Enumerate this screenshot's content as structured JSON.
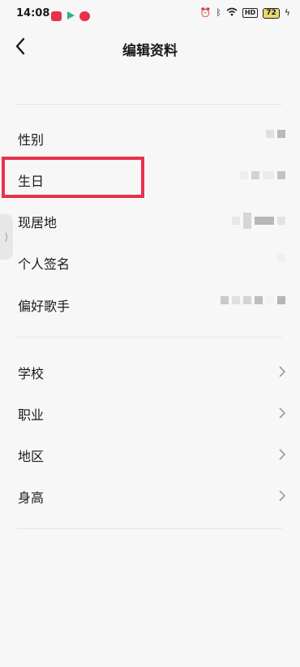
{
  "status_bar": {
    "time": "14:08",
    "battery": "72",
    "hd": "HD",
    "icons": [
      "app-notification-icon",
      "play-store-icon",
      "app-icon",
      "alarm-icon",
      "bluetooth-icon",
      "wifi-icon",
      "hd-icon",
      "battery-icon",
      "charging-icon"
    ]
  },
  "header": {
    "title": "编辑资料"
  },
  "profile_fields": [
    {
      "label": "性别"
    },
    {
      "label": "生日"
    },
    {
      "label": "现居地"
    },
    {
      "label": "个人签名"
    },
    {
      "label": "偏好歌手"
    }
  ],
  "detail_fields": [
    {
      "label": "学校"
    },
    {
      "label": "职业"
    },
    {
      "label": "地区"
    },
    {
      "label": "身高"
    }
  ],
  "colors": {
    "highlight": "#e8324a",
    "background": "#f7f7f8"
  }
}
